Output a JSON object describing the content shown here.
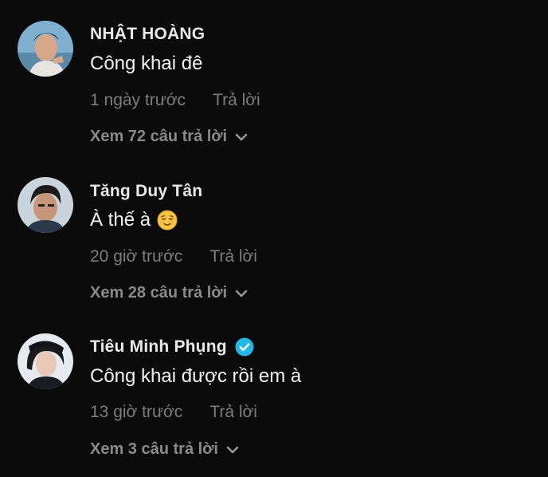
{
  "comments": [
    {
      "username": "NHẬT HOÀNG",
      "text": "Công khai đê",
      "time": "1 ngày trước",
      "reply_label": "Trả lời",
      "view_replies": "Xem 72 câu trả lời",
      "verified": false,
      "emoji": ""
    },
    {
      "username": "Tăng Duy Tân",
      "text": "À thế à",
      "time": "20 giờ trước",
      "reply_label": "Trả lời",
      "view_replies": "Xem 28 câu trả lời",
      "verified": false,
      "emoji": "relieved-face"
    },
    {
      "username": "Tiêu Minh Phụng",
      "text": "Công khai được rồi em à",
      "time": "13 giờ trước",
      "reply_label": "Trả lời",
      "view_replies": "Xem 3 câu trả lời",
      "verified": true,
      "emoji": ""
    }
  ],
  "colors": {
    "background": "#0b0b0b",
    "username": "#e9e9e9",
    "text": "#f2f2f2",
    "meta": "#7d7d7d",
    "verified": "#20b8e6"
  },
  "icons": {
    "verified": "verified-badge-icon",
    "chevron": "chevron-down-icon",
    "emoji": "relieved-face-icon"
  }
}
